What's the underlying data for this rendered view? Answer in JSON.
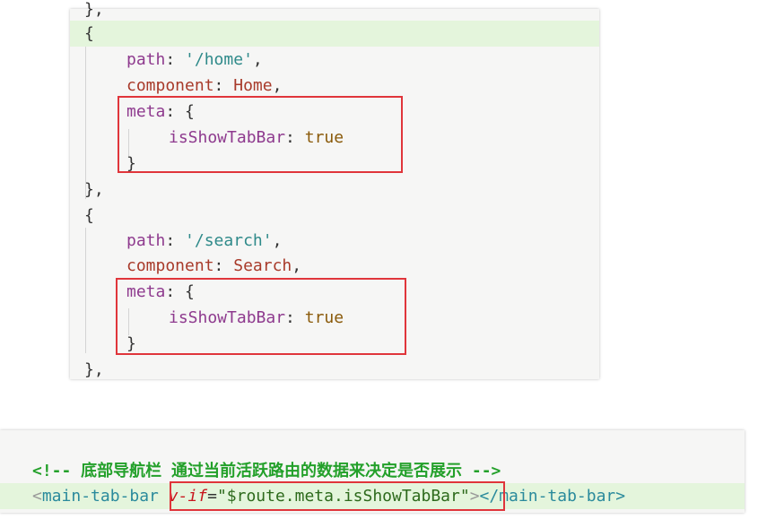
{
  "code_block_1": {
    "line0": "},",
    "obj_open": "{",
    "path_key": "path",
    "path_val_1": "'/home'",
    "component_key": "component",
    "component_val_1": "Home",
    "meta_key": "meta",
    "brace_open": "{",
    "isShow_key": "isShowTabBar",
    "true_val": "true",
    "brace_close": "}",
    "obj_close": "},",
    "path_val_2": "'/search'",
    "component_val_2": "Search",
    "comma": ",",
    "colon": ":"
  },
  "code_block_2": {
    "comment": "<!-- 底部导航栏 通过当前活跃路由的数据来决定是否展示 -->",
    "lt": "<",
    "gt": ">",
    "tag_name": "main-tab-bar",
    "attr": "v-if",
    "eq": "=",
    "attr_value": "\"$route.meta.isShowTabBar\"",
    "close_tag": "</main-tab-bar>"
  },
  "colors": {
    "highlight_line": "#e4f5dc",
    "annotation_box": "#e0353b"
  }
}
